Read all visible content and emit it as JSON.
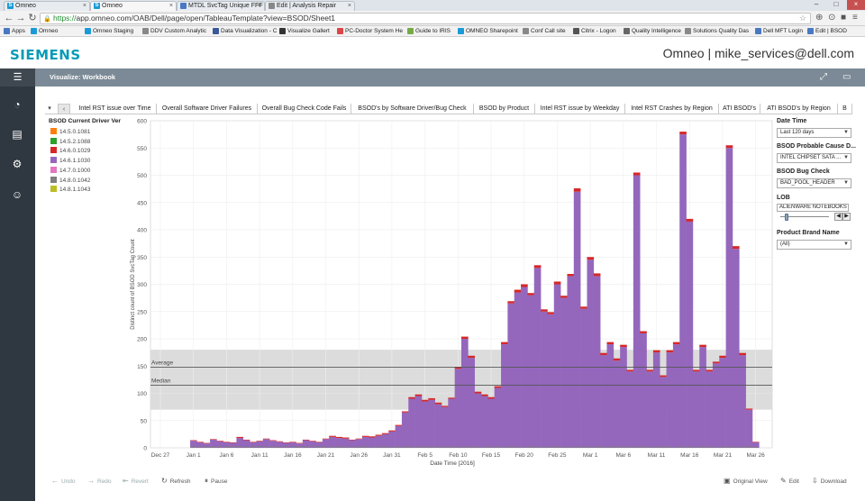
{
  "browser": {
    "tabs": [
      {
        "label": "Omneo",
        "active": false
      },
      {
        "label": "Omneo",
        "active": true
      },
      {
        "label": "MTDL SvcTag Unique FFF",
        "active": false
      },
      {
        "label": "Edit | Analysis Repair",
        "active": false
      }
    ],
    "url_scheme": "https://",
    "url_rest": "app.omneo.com/OAB/Dell/page/open/TableauTemplate?view=BSOD/Sheet1",
    "bookmarks": [
      {
        "label": "Apps",
        "color": "#4a78c2"
      },
      {
        "label": "Omneo",
        "color": "#1a9bd7"
      },
      {
        "label": "Omneo Staging",
        "color": "#1a9bd7"
      },
      {
        "label": "DDV Custom Analytic",
        "color": "#888888"
      },
      {
        "label": "Data Visualization - C",
        "color": "#3b5998"
      },
      {
        "label": "Visualize Gallert",
        "color": "#333333"
      },
      {
        "label": "PC-Doctor System He",
        "color": "#d44"
      },
      {
        "label": "Guide to IRIS",
        "color": "#7a4"
      },
      {
        "label": "OMNEO Sharepoint",
        "color": "#1a9bd7"
      },
      {
        "label": "Conf Call site",
        "color": "#888888"
      },
      {
        "label": "Citrix - Logon",
        "color": "#555555"
      },
      {
        "label": "Quality Intelligence",
        "color": "#666666"
      },
      {
        "label": "Solutions Quality Das",
        "color": "#888888"
      },
      {
        "label": "Dell MFT Login",
        "color": "#4a78c2"
      },
      {
        "label": "Edit | BSOD",
        "color": "#4a78c2"
      }
    ]
  },
  "header": {
    "logo": "SIEMENS",
    "user_title": "Omneo | mike_services@dell.com"
  },
  "toolbar": {
    "title": "Visualize: Workbook"
  },
  "sheet_tabs": [
    "Intel RST issue over Time",
    "Overall Software Driver Failures",
    "Overall Bug Check Code Fails",
    "BSOD's by Software Driver/Bug Check",
    "BSOD by Product",
    "Intel RST issue by Weekday",
    "Intel RST Crashes by Region",
    "ATI BSOD's",
    "ATI BSOD's by Region",
    "B"
  ],
  "legend": {
    "title": "BSOD Current Driver Ver",
    "items": [
      {
        "label": "14.5.0.1081",
        "color": "#ff7f0e"
      },
      {
        "label": "14.5.2.1088",
        "color": "#2ca02c"
      },
      {
        "label": "14.6.0.1029",
        "color": "#d62728"
      },
      {
        "label": "14.6.1.1030",
        "color": "#9467bd"
      },
      {
        "label": "14.7.0.1000",
        "color": "#e377c2"
      },
      {
        "label": "14.8.0.1042",
        "color": "#7f7f7f"
      },
      {
        "label": "14.8.1.1043",
        "color": "#bcbd22"
      }
    ]
  },
  "filters": {
    "date_time": {
      "label": "Date Time",
      "value": "Last 120 days"
    },
    "probable_cause": {
      "label": "BSOD Probable Cause D...",
      "value": "INTEL CHIPSET SATA ..."
    },
    "bug_check": {
      "label": "BSOD Bug Check",
      "value": "BAD_POOL_HEADER"
    },
    "lob": {
      "label": "LOB",
      "value": "ALIENWARE NOTEBOOKS"
    },
    "product_brand": {
      "label": "Product Brand Name",
      "value": "(All)"
    }
  },
  "bottom_bar": {
    "undo": "Undo",
    "redo": "Redo",
    "revert": "Revert",
    "refresh": "Refresh",
    "pause": "Pause",
    "original_view": "Original View",
    "edit": "Edit",
    "download": "Download"
  },
  "chart_data": {
    "type": "bar",
    "xlabel": "Date Time [2016]",
    "ylabel": "Distinct count of BSOD SvcTag Count",
    "ylim": [
      0,
      600
    ],
    "yticks": [
      0,
      50,
      100,
      150,
      200,
      250,
      300,
      350,
      400,
      450,
      500,
      550,
      600
    ],
    "xticks": [
      "Dec 27",
      "Jan 1",
      "Jan 6",
      "Jan 11",
      "Jan 16",
      "Jan 21",
      "Jan 26",
      "Jan 31",
      "Feb 5",
      "Feb 10",
      "Feb 15",
      "Feb 20",
      "Feb 25",
      "Mar 1",
      "Mar 6",
      "Mar 11",
      "Mar 16",
      "Mar 21",
      "Mar 26"
    ],
    "reference_lines": [
      {
        "label": "Average",
        "value": 148
      },
      {
        "label": "Median",
        "value": 115
      }
    ],
    "reference_band": [
      70,
      180
    ],
    "grid": true,
    "main_series": "14.6.1.1030",
    "values": [
      13,
      10,
      8,
      15,
      12,
      10,
      9,
      18,
      14,
      10,
      12,
      16,
      13,
      11,
      9,
      10,
      8,
      14,
      12,
      10,
      16,
      20,
      18,
      17,
      14,
      16,
      20,
      19,
      22,
      25,
      30,
      40,
      65,
      90,
      95,
      85,
      88,
      80,
      75,
      90,
      145,
      200,
      165,
      100,
      95,
      90,
      110,
      190,
      265,
      285,
      295,
      280,
      330,
      250,
      245,
      300,
      275,
      315,
      470,
      255,
      345,
      315,
      170,
      190,
      160,
      185,
      140,
      500,
      210,
      140,
      175,
      130,
      175,
      190,
      575,
      415,
      140,
      185,
      140,
      155,
      165,
      550,
      365,
      170,
      70,
      10
    ],
    "top_series": "14.6.0.1029",
    "top_values": [
      1,
      1,
      1,
      1,
      1,
      1,
      1,
      2,
      1,
      1,
      1,
      1,
      1,
      1,
      1,
      1,
      1,
      1,
      1,
      1,
      1,
      2,
      2,
      2,
      1,
      1,
      2,
      2,
      2,
      2,
      2,
      2,
      2,
      3,
      3,
      3,
      3,
      3,
      2,
      2,
      3,
      4,
      4,
      3,
      3,
      3,
      3,
      4,
      4,
      5,
      5,
      4,
      5,
      4,
      4,
      5,
      4,
      4,
      6,
      4,
      5,
      5,
      4,
      4,
      4,
      4,
      3,
      5,
      4,
      3,
      4,
      3,
      4,
      4,
      5,
      5,
      3,
      4,
      3,
      3,
      4,
      5,
      5,
      4,
      2,
      1
    ]
  }
}
